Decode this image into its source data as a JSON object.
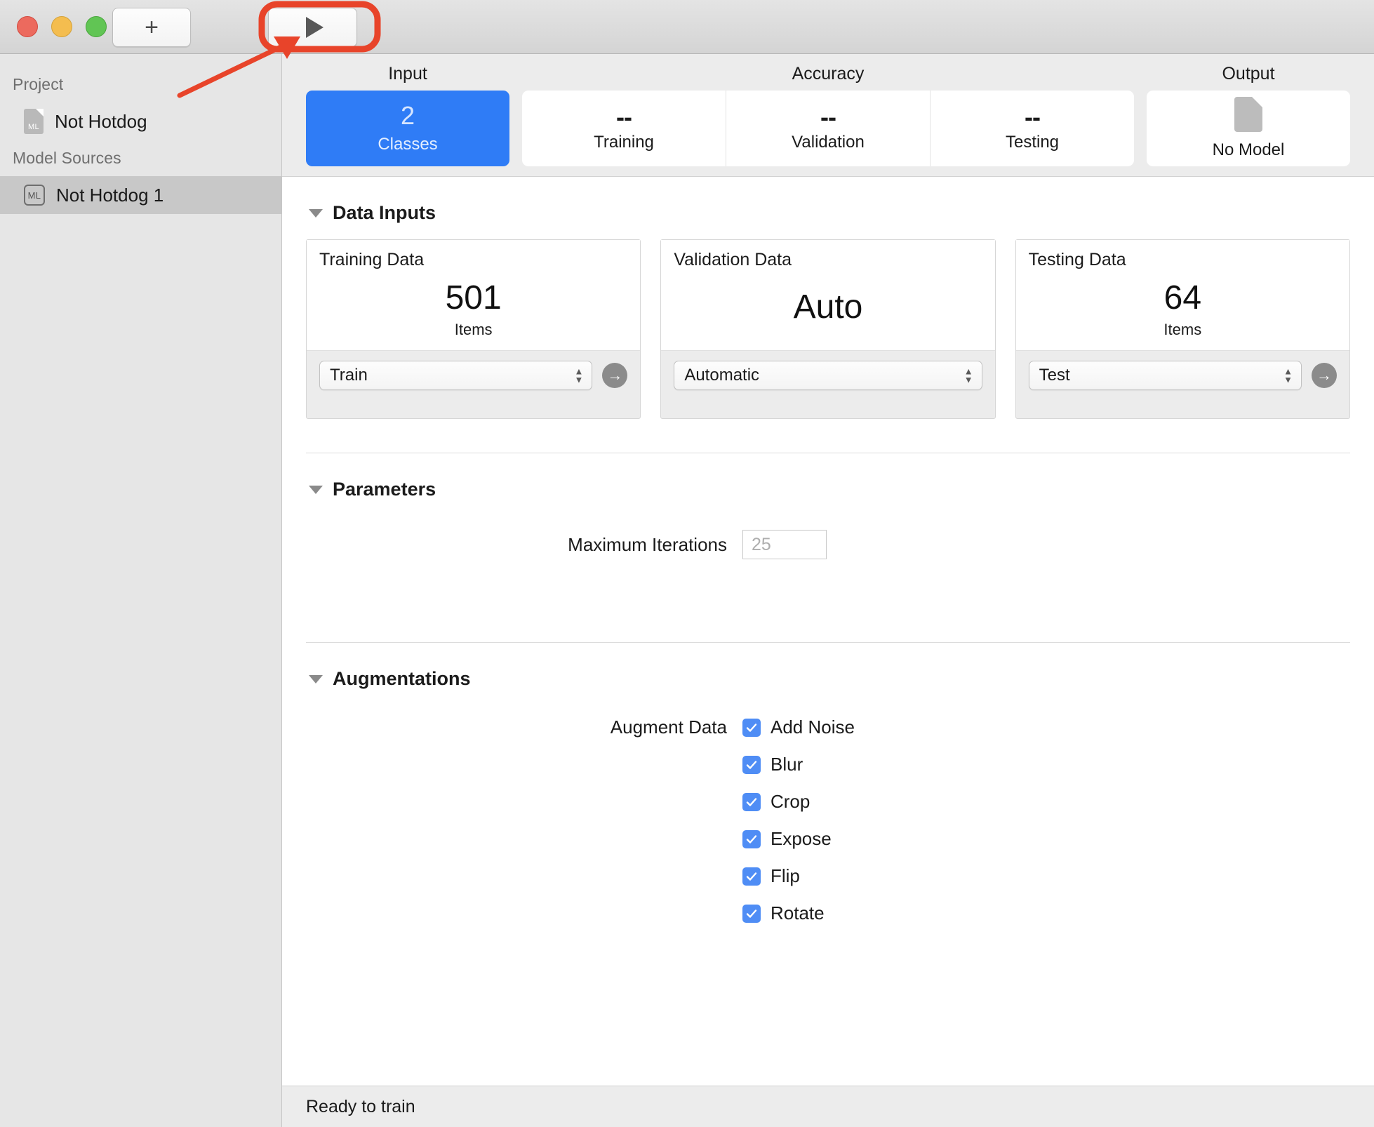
{
  "window": {
    "traffic_lights": [
      "close",
      "minimize",
      "zoom"
    ],
    "toolbar": {
      "add_label": "+",
      "play_label": "play-triangle"
    }
  },
  "sidebar": {
    "sections": [
      {
        "header": "Project",
        "items": [
          {
            "label": "Not Hotdog",
            "icon": "ml-document-icon",
            "selected": false
          }
        ]
      },
      {
        "header": "Model Sources",
        "items": [
          {
            "label": "Not Hotdog 1",
            "icon": "ml-badge-icon",
            "selected": true
          }
        ]
      }
    ]
  },
  "metrics": {
    "group_titles": {
      "input": "Input",
      "accuracy": "Accuracy",
      "output": "Output"
    },
    "input": {
      "value": "2",
      "label": "Classes",
      "color": "#2f7cf6"
    },
    "accuracy": [
      {
        "value": "--",
        "label": "Training"
      },
      {
        "value": "--",
        "label": "Validation"
      },
      {
        "value": "--",
        "label": "Testing"
      }
    ],
    "output": {
      "icon": "no-model-document-icon",
      "label": "No Model"
    }
  },
  "data_inputs": {
    "section_title": "Data Inputs",
    "cards": [
      {
        "title": "Training Data",
        "value": "501",
        "units": "Items",
        "select_value": "Train",
        "has_reveal_button": true
      },
      {
        "title": "Validation Data",
        "value": "Auto",
        "units": "",
        "select_value": "Automatic",
        "has_reveal_button": false
      },
      {
        "title": "Testing Data",
        "value": "64",
        "units": "Items",
        "select_value": "Test",
        "has_reveal_button": true
      }
    ]
  },
  "parameters": {
    "section_title": "Parameters",
    "max_iterations": {
      "label": "Maximum Iterations",
      "value": "",
      "placeholder": "25"
    }
  },
  "augmentations": {
    "section_title": "Augmentations",
    "field_label": "Augment Data",
    "options": [
      {
        "label": "Add Noise",
        "checked": true
      },
      {
        "label": "Blur",
        "checked": true
      },
      {
        "label": "Crop",
        "checked": true
      },
      {
        "label": "Expose",
        "checked": true
      },
      {
        "label": "Flip",
        "checked": true
      },
      {
        "label": "Rotate",
        "checked": true
      }
    ],
    "checkbox_color": "#4f8df5"
  },
  "statusbar": {
    "text": "Ready to train"
  },
  "annotations": {
    "highlight_color": "#e8442a",
    "highlight_target": "play-button",
    "arrow": {
      "from": [
        255,
        136
      ],
      "to": [
        424,
        56
      ]
    }
  }
}
